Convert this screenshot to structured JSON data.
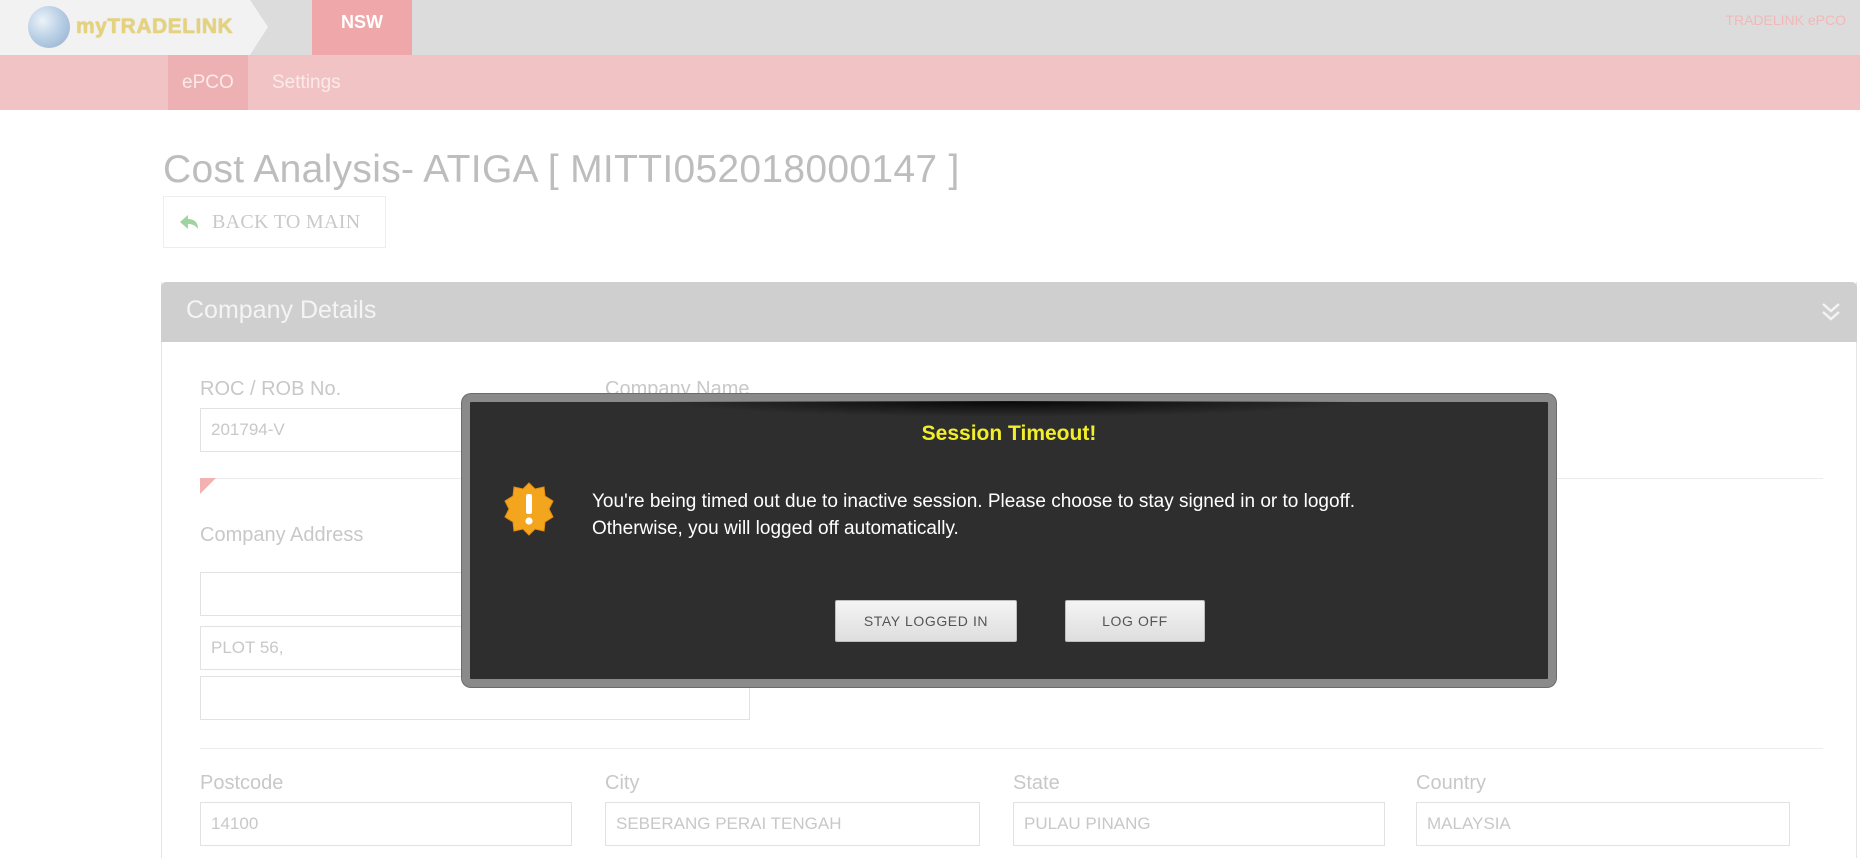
{
  "header": {
    "logo_text": "myTRADELINK",
    "active_tab": "NSW",
    "top_right_link": "TRADELINK ePCO"
  },
  "subnav": {
    "items": [
      "ePCO",
      "Settings"
    ]
  },
  "page": {
    "title": "Cost Analysis- ATIGA [ MITTI052018000147 ]",
    "back_button": "BACK TO MAIN"
  },
  "company_panel": {
    "header": "Company Details",
    "roc_label": "ROC / ROB No.",
    "roc_value": "201794-V",
    "name_label": "Company Name",
    "address_label": "Company Address",
    "address_lines": [
      "",
      "PLOT 56,",
      ""
    ],
    "postcode_label": "Postcode",
    "postcode_value": "14100",
    "city_label": "City",
    "city_value": "SEBERANG PERAI TENGAH",
    "state_label": "State",
    "state_value": "PULAU PINANG",
    "country_label": "Country",
    "country_value": "MALAYSIA"
  },
  "modal": {
    "title": "Session Timeout!",
    "line1": "You're being timed out due to inactive session. Please choose to stay signed in or to logoff.",
    "line2": "Otherwise, you will logged off automatically.",
    "stay_button": "STAY LOGGED IN",
    "logoff_button": "LOG OFF"
  },
  "colors": {
    "brand_pink": "#f0a7a9",
    "modal_bg": "#2e2e2e",
    "modal_title": "#f2ef2a",
    "warning_orange": "#f3a51e"
  },
  "icons": [
    "globe-logo-icon",
    "back-arrow-icon",
    "double-chevron-down-icon",
    "warning-icon"
  ]
}
